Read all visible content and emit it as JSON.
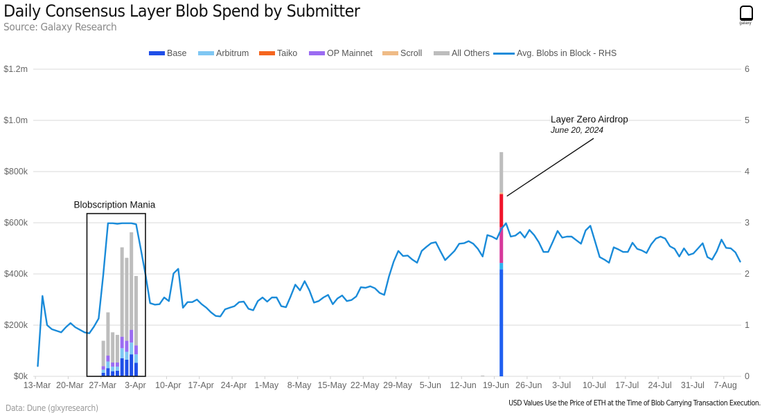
{
  "header": {
    "title": "Daily Consensus Layer Blob Spend by Submitter",
    "subtitle": "Source: Galaxy Research",
    "logo_icon": "galaxy-logo-icon",
    "logo_text": "galaxy"
  },
  "footer": {
    "data_source": "Data: Dune (glxyresearch)",
    "note": "USD Values Use the Price of ETH at the Time of Blob Carrying Transaction Execution."
  },
  "chart_data": {
    "type": "bar",
    "title": "Daily Consensus Layer Blob Spend by Submitter",
    "subtitle": "Source: Galaxy Research",
    "xlabel": "",
    "ylabel": "",
    "ylabel_right": "",
    "ylim": [
      0,
      1200000
    ],
    "ylim_right": [
      0,
      6
    ],
    "grid": true,
    "legend_placement": "top-center",
    "y_ticks": [
      "$0k",
      "$200k",
      "$400k",
      "$600k",
      "$800k",
      "$1.0m",
      "$1.2m"
    ],
    "y_ticks_right": [
      "0",
      "1",
      "2",
      "3",
      "4",
      "5",
      "6"
    ],
    "x_start_date": "13-Mar",
    "x_ticks": [
      "13-Mar",
      "20-Mar",
      "27-Mar",
      "3-Apr",
      "10-Apr",
      "17-Apr",
      "24-Apr",
      "1-May",
      "8-May",
      "15-May",
      "22-May",
      "29-May",
      "5-Jun",
      "12-Jun",
      "19-Jun",
      "26-Jun",
      "3-Jul",
      "10-Jul",
      "17-Jul",
      "24-Jul",
      "31-Jul",
      "7-Aug"
    ],
    "x_tick_day_index": [
      0,
      7,
      14,
      21,
      28,
      35,
      42,
      49,
      56,
      63,
      70,
      77,
      84,
      91,
      98,
      105,
      112,
      119,
      126,
      133,
      140,
      147
    ],
    "series": [
      {
        "name": "Base",
        "kind": "bar",
        "color": "#1f4fe8"
      },
      {
        "name": "Arbitrum",
        "kind": "bar",
        "color": "#7fc7f3"
      },
      {
        "name": "Taiko",
        "kind": "bar",
        "color": "#f5661f"
      },
      {
        "name": "OP Mainnet",
        "kind": "bar",
        "color": "#9b6cf2"
      },
      {
        "name": "Scroll",
        "kind": "bar",
        "color": "#efbb86"
      },
      {
        "name": "All Others",
        "kind": "bar",
        "color": "#bdbdbd"
      },
      {
        "name": "Avg. Blobs in Block - RHS",
        "kind": "line",
        "axis": "right",
        "color": "#1a8bd9"
      }
    ],
    "bars": [
      {
        "date": "27-Mar",
        "day": 14,
        "segments": [
          {
            "series": "Base",
            "value": 14000
          },
          {
            "series": "Arbitrum",
            "value": 12000
          },
          {
            "series": "OP Mainnet",
            "value": 14000
          },
          {
            "series": "All Others",
            "value": 99000
          }
        ],
        "total": 139000
      },
      {
        "date": "28-Mar",
        "day": 15,
        "segments": [
          {
            "series": "Base",
            "value": 32000
          },
          {
            "series": "Arbitrum",
            "value": 26000
          },
          {
            "series": "OP Mainnet",
            "value": 23000
          },
          {
            "series": "All Others",
            "value": 169000
          }
        ],
        "total": 250000
      },
      {
        "date": "29-Mar",
        "day": 16,
        "segments": [
          {
            "series": "Base",
            "value": 20000
          },
          {
            "series": "Arbitrum",
            "value": 18000
          },
          {
            "series": "OP Mainnet",
            "value": 16000
          },
          {
            "series": "All Others",
            "value": 118000
          }
        ],
        "total": 172000
      },
      {
        "date": "30-Mar",
        "day": 17,
        "segments": [
          {
            "series": "Base",
            "value": 22000
          },
          {
            "series": "Arbitrum",
            "value": 16000
          },
          {
            "series": "OP Mainnet",
            "value": 16000
          },
          {
            "series": "All Others",
            "value": 108000
          }
        ],
        "total": 162000
      },
      {
        "date": "31-Mar",
        "day": 18,
        "segments": [
          {
            "series": "Base",
            "value": 71000
          },
          {
            "series": "Arbitrum",
            "value": 39000
          },
          {
            "series": "OP Mainnet",
            "value": 45000
          },
          {
            "series": "All Others",
            "value": 349000
          }
        ],
        "total": 504000
      },
      {
        "date": "1-Apr",
        "day": 19,
        "segments": [
          {
            "series": "Base",
            "value": 65000
          },
          {
            "series": "Arbitrum",
            "value": 31000
          },
          {
            "series": "OP Mainnet",
            "value": 43000
          },
          {
            "series": "All Others",
            "value": 324000
          }
        ],
        "total": 463000
      },
      {
        "date": "2-Apr",
        "day": 20,
        "segments": [
          {
            "series": "Base",
            "value": 86000
          },
          {
            "series": "Arbitrum",
            "value": 46000
          },
          {
            "series": "OP Mainnet",
            "value": 50000
          },
          {
            "series": "All Others",
            "value": 381000
          }
        ],
        "total": 563000
      },
      {
        "date": "3-Apr",
        "day": 21,
        "segments": [
          {
            "series": "Base",
            "value": 53000
          },
          {
            "series": "Arbitrum",
            "value": 33000
          },
          {
            "series": "OP Mainnet",
            "value": 35000
          },
          {
            "series": "All Others",
            "value": 271000
          }
        ],
        "total": 392000
      },
      {
        "date": "16-Jun",
        "day": 95,
        "segments": [
          {
            "series": "All Others",
            "value": 3000
          }
        ],
        "total": 3000
      },
      {
        "date": "20-Jun",
        "day": 99,
        "segments": [
          {
            "series": "Base",
            "value": 418000,
            "color": "#1f5ff0"
          },
          {
            "series": "Arbitrum",
            "value": 25000,
            "color": "#2fb3ef"
          },
          {
            "series": "Taiko",
            "value": 140000,
            "color": "#d6389b"
          },
          {
            "series": "OP Mainnet",
            "value": 129000,
            "color": "#f0142a"
          },
          {
            "series": "Scroll",
            "value": 6000,
            "color": "#efbb86"
          },
          {
            "series": "All Others",
            "value": 158000
          }
        ],
        "total": 876000
      }
    ],
    "line": {
      "series": "Avg. Blobs in Block - RHS",
      "values": [
        0.2,
        1.57,
        1.0,
        0.92,
        0.89,
        0.86,
        0.96,
        1.04,
        0.96,
        0.91,
        0.86,
        0.84,
        0.97,
        1.13,
        1.99,
        2.99,
        2.99,
        2.98,
        2.99,
        2.99,
        2.99,
        2.97,
        2.49,
        1.99,
        1.43,
        1.4,
        1.41,
        1.54,
        1.47,
        2.01,
        2.1,
        1.34,
        1.45,
        1.45,
        1.5,
        1.41,
        1.34,
        1.25,
        1.18,
        1.17,
        1.31,
        1.34,
        1.37,
        1.45,
        1.46,
        1.32,
        1.29,
        1.47,
        1.54,
        1.46,
        1.54,
        1.54,
        1.37,
        1.35,
        1.56,
        1.79,
        1.68,
        1.86,
        1.68,
        1.44,
        1.47,
        1.54,
        1.59,
        1.41,
        1.52,
        1.58,
        1.47,
        1.49,
        1.56,
        1.74,
        1.73,
        1.76,
        1.72,
        1.63,
        1.59,
        1.95,
        2.24,
        2.45,
        2.35,
        2.36,
        2.28,
        2.22,
        2.45,
        2.53,
        2.6,
        2.62,
        2.44,
        2.27,
        2.36,
        2.45,
        2.59,
        2.6,
        2.64,
        2.59,
        2.49,
        2.34,
        2.76,
        2.73,
        2.68,
        2.88,
        2.99,
        2.73,
        2.75,
        2.82,
        2.71,
        2.86,
        2.76,
        2.62,
        2.43,
        2.43,
        2.63,
        2.84,
        2.71,
        2.73,
        2.73,
        2.66,
        2.59,
        2.85,
        2.94,
        2.64,
        2.33,
        2.28,
        2.22,
        2.52,
        2.48,
        2.43,
        2.43,
        2.61,
        2.49,
        2.46,
        2.41,
        2.58,
        2.69,
        2.73,
        2.69,
        2.54,
        2.49,
        2.34,
        2.5,
        2.37,
        2.4,
        2.5,
        2.6,
        2.33,
        2.28,
        2.44,
        2.67,
        2.51,
        2.5,
        2.42,
        2.24
      ]
    },
    "annotations": [
      {
        "id": "blobscription",
        "text": "Blobscription Mania",
        "kind": "box",
        "day_range": [
          10.5,
          23
        ],
        "value_top": 636000
      },
      {
        "id": "layer-zero",
        "text": "Layer Zero Airdrop",
        "subtext": "June 20, 2024",
        "kind": "arrow",
        "target_day": 99,
        "target_value": 712000
      }
    ]
  }
}
